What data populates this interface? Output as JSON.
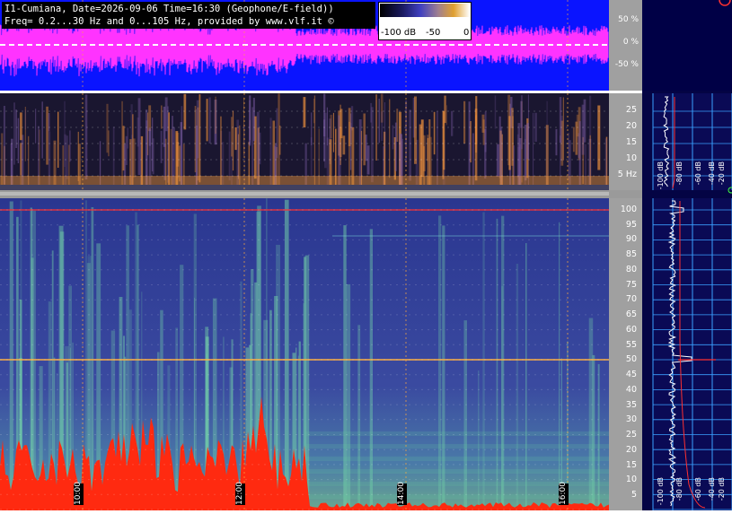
{
  "header": {
    "line1": "I1-Cumiana, Date=2026-09-06 Time=16:30 (Geophone/E-field))",
    "line2": "Freq= 0.2...30 Hz and 0...105 Hz, provided by www.vlf.it ©"
  },
  "color_scale": {
    "labels": [
      "-100 dB",
      "-50",
      "0"
    ]
  },
  "amplitude_axis": {
    "labels": [
      "50 %",
      "0 %",
      "-50 %"
    ]
  },
  "low_freq_axis": {
    "labels": [
      "25",
      "20",
      "15",
      "10",
      "5 Hz"
    ]
  },
  "high_freq_axis": {
    "labels": [
      "100",
      "95",
      "90",
      "85",
      "80",
      "75",
      "70",
      "65",
      "60",
      "55",
      "50",
      "45",
      "40",
      "35",
      "30",
      "25",
      "20",
      "15",
      "10",
      "5"
    ]
  },
  "time_labels": [
    "10:00",
    "12:00",
    "14:00",
    "16:00"
  ],
  "spectrum_db_top": [
    "-100 dB",
    "-80 dB",
    "-60 dB",
    "-40 dB",
    "-20 dB"
  ],
  "spectrum_db_bottom": [
    "-100 dB",
    "-80 dB",
    "-60 dB",
    "-40 dB",
    "-20 dB"
  ],
  "colors": {
    "waveform_bg": "#0a14ff",
    "waveform": "#ff33ff",
    "trace": "#ffffff",
    "mains_line": "#ff3030"
  }
}
